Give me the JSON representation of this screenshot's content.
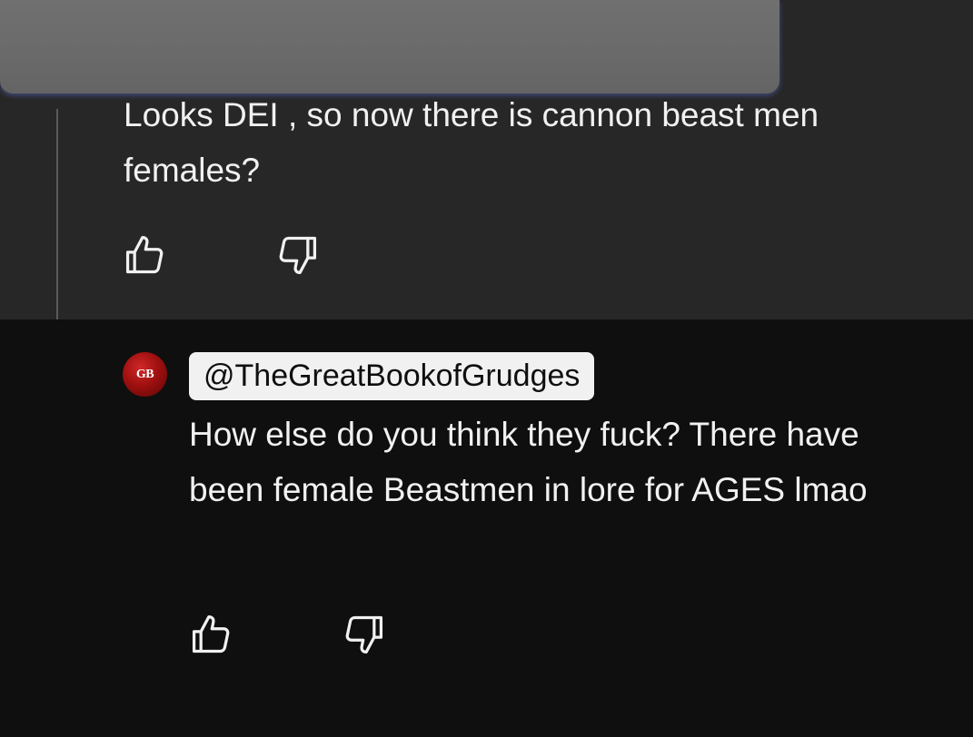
{
  "parent_comment": {
    "text": "Looks DEI , so now there is cannon beast men females?",
    "like_icon": "thumbs-up-icon",
    "dislike_icon": "thumbs-down-icon"
  },
  "reply": {
    "avatar_text": "GB",
    "author": "@TheGreatBookofGrudges",
    "text": "How else do you think they fuck? There have been female Beastmen in lore for AGES lmao",
    "like_icon": "thumbs-up-icon",
    "dislike_icon": "thumbs-down-icon"
  },
  "colors": {
    "parent_background": "#272727",
    "page_background": "#0f0f0f",
    "text": "#f1f1f1",
    "author_chip_background": "#f1f1f1",
    "avatar_red": "#a01010"
  }
}
